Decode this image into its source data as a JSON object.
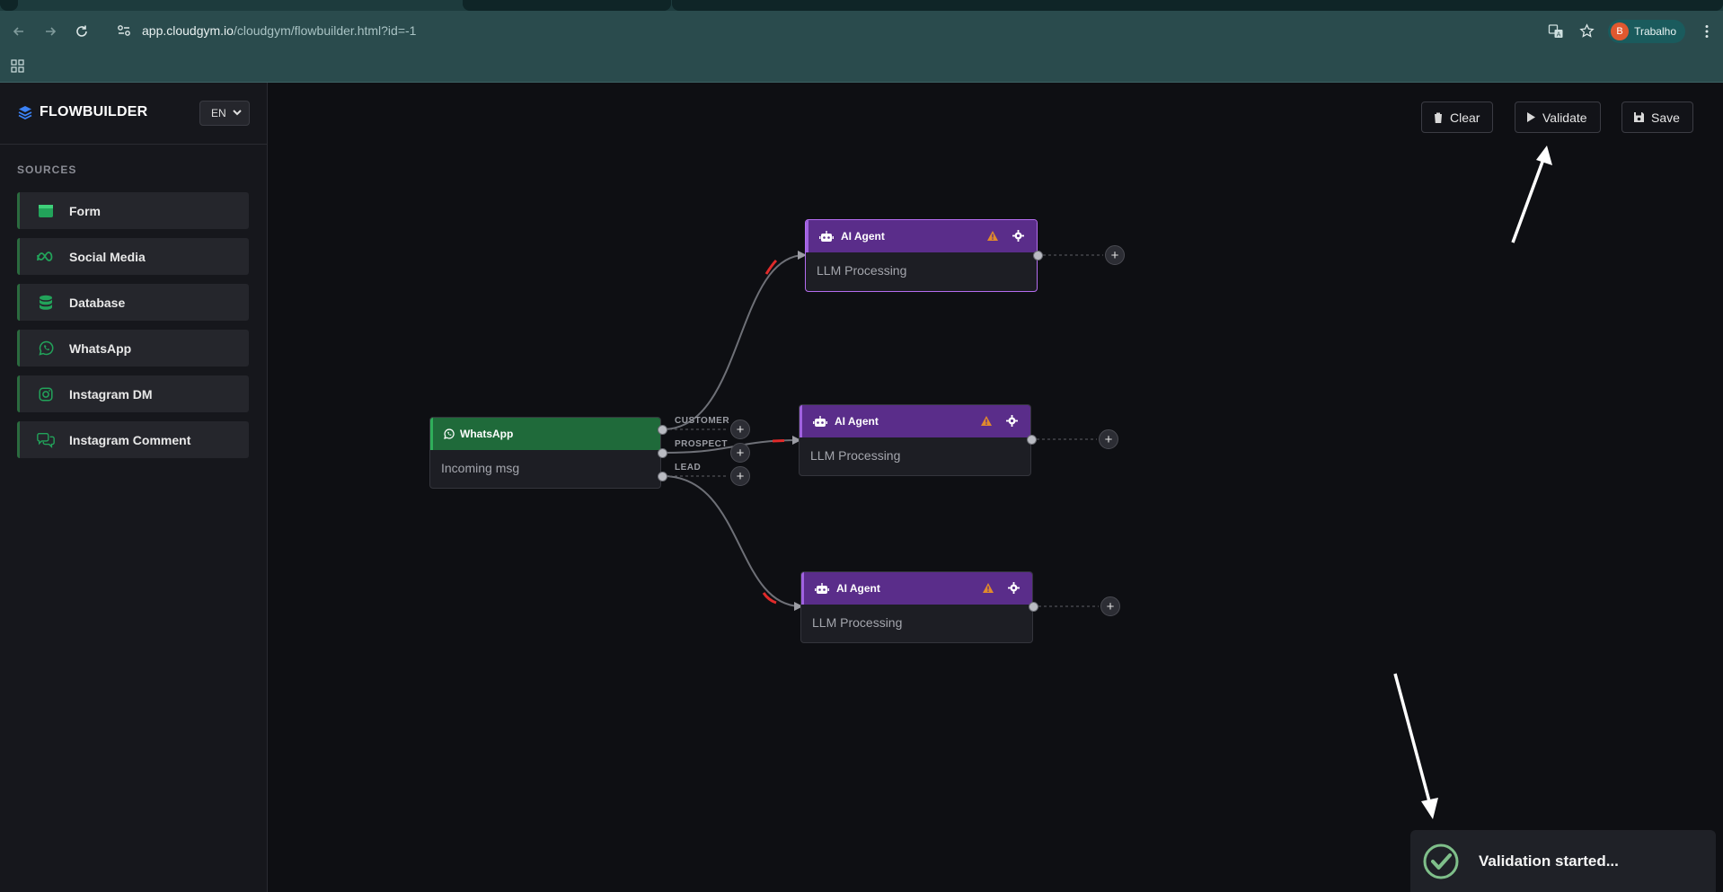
{
  "browser": {
    "url_host": "app.cloudgym.io",
    "url_path": "/cloudgym/flowbuilder.html?id=-1",
    "profile_initial": "B",
    "profile_name": "Trabalho"
  },
  "sidebar": {
    "brand": "FLOWBUILDER",
    "language": "EN",
    "section_title": "SOURCES",
    "items": [
      {
        "label": "Form",
        "icon": "form-icon"
      },
      {
        "label": "Social Media",
        "icon": "meta-icon"
      },
      {
        "label": "Database",
        "icon": "database-icon"
      },
      {
        "label": "WhatsApp",
        "icon": "whatsapp-icon"
      },
      {
        "label": "Instagram DM",
        "icon": "instagram-icon"
      },
      {
        "label": "Instagram Comment",
        "icon": "comment-icon"
      }
    ]
  },
  "toolbar": {
    "clear_label": "Clear",
    "validate_label": "Validate",
    "save_label": "Save"
  },
  "nodes": {
    "whatsapp": {
      "title": "WhatsApp",
      "subtitle": "Incoming msg"
    },
    "ai1": {
      "title": "AI Agent",
      "subtitle": "LLM Processing"
    },
    "ai2": {
      "title": "AI Agent",
      "subtitle": "LLM Processing"
    },
    "ai3": {
      "title": "AI Agent",
      "subtitle": "LLM Processing"
    }
  },
  "edge_labels": {
    "customer": "CUSTOMER",
    "prospect": "PROSPECT",
    "lead": "LEAD"
  },
  "toast": {
    "message": "Validation started..."
  },
  "colors": {
    "whatsapp_green": "#1f6a3a",
    "ai_purple": "#5a2d8a",
    "accent_blue": "#3b82f6",
    "warning": "#e08a2c"
  }
}
